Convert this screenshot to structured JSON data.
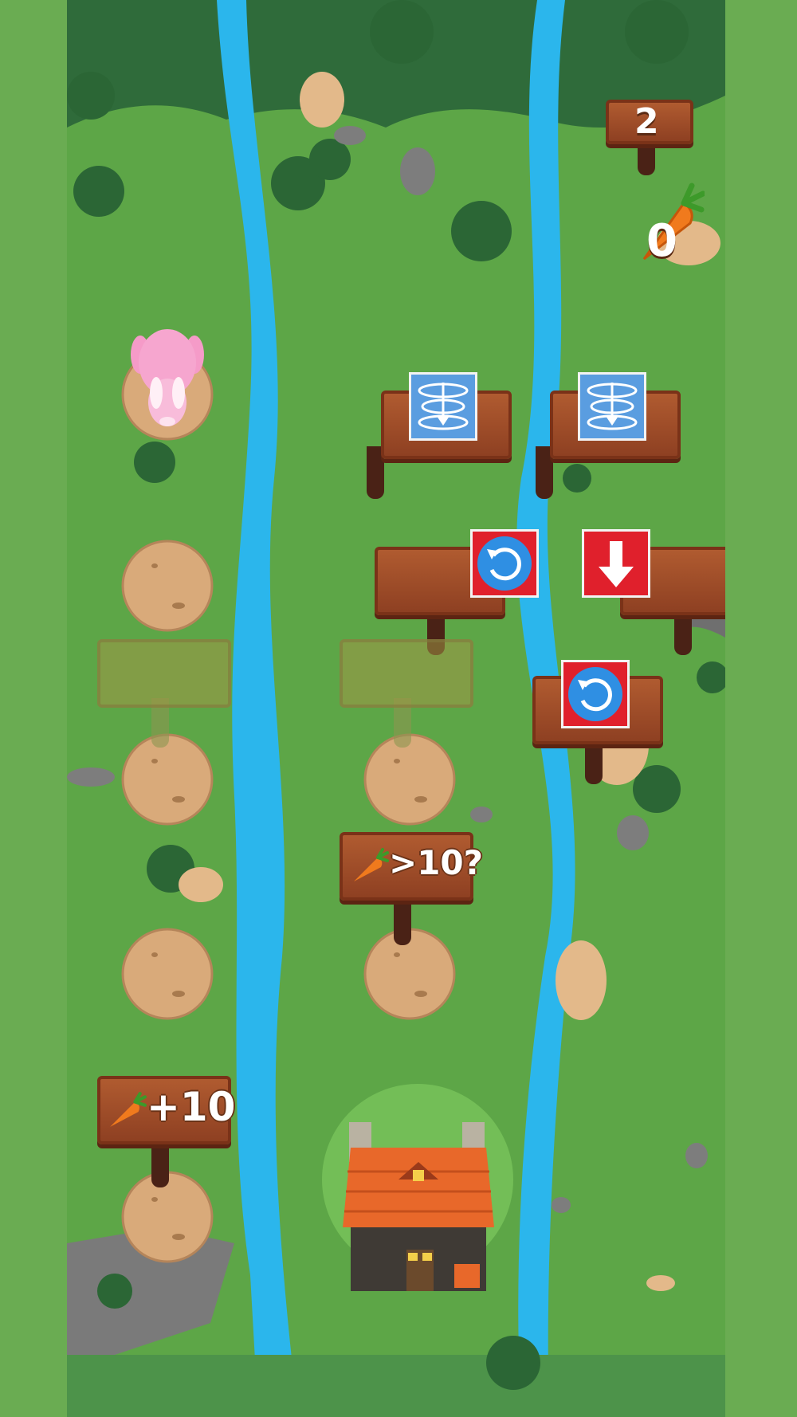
{
  "hud": {
    "level_label": "2",
    "carrot_count": "0",
    "carrot_icon": "carrot-icon"
  },
  "signs": {
    "carrot_check_label": ">10?",
    "carrot_bonus_label": "+10",
    "vortex_icon": "vortex-down-icon",
    "rotate_icon": "rotate-counterclockwise-icon",
    "down_arrow_icon": "arrow-down-icon"
  },
  "player": {
    "name": "pink-bunny"
  },
  "colors": {
    "grass": "#5da647",
    "river": "#2bb6ec",
    "wood": "#9c4a26",
    "card_blue": "#5a9de0",
    "card_red": "#e0202c"
  }
}
